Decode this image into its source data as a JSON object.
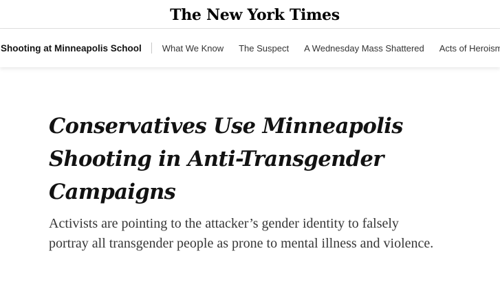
{
  "masthead": {
    "logo_text": "The New York Times"
  },
  "subnav": {
    "section_title": "Shooting at Minneapolis School",
    "links": [
      "What We Know",
      "The Suspect",
      "A Wednesday Mass Shattered",
      "Acts of Heroism"
    ]
  },
  "article": {
    "headline": "Conservatives Use Minneapolis Shooting in Anti-Transgender Campaigns",
    "summary": "Activists are pointing to the attacker’s gender identity to falsely portray all transgender people as prone to mental illness and violence."
  }
}
